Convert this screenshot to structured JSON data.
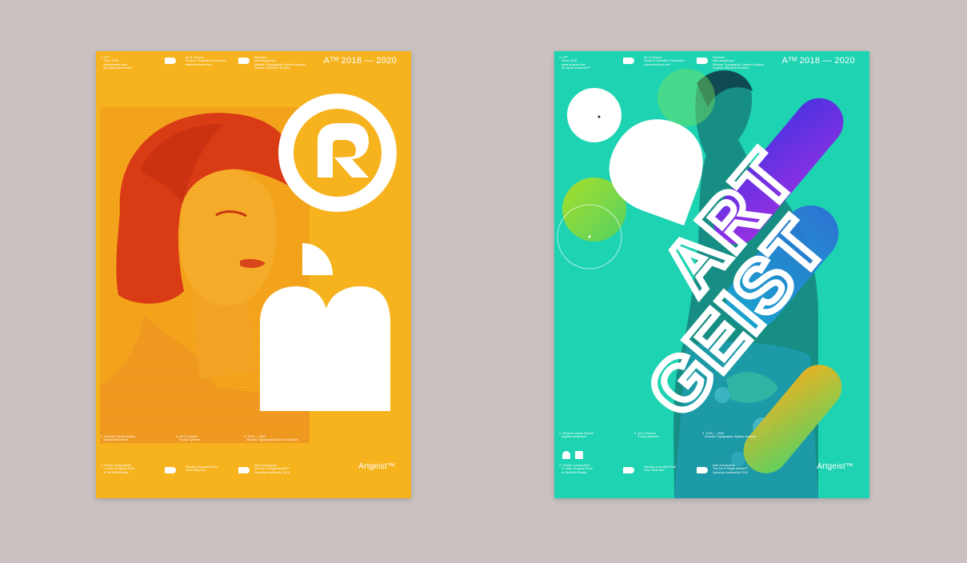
{
  "scene": {
    "background": "#c9c2c1"
  },
  "posters": [
    {
      "id": "left",
      "color": "#f6b31e",
      "year_range": "Aᵀᴹ 2018 — 2020",
      "brand": "Artgeist™",
      "header": [
        "●  Aᵀᴹ\n   Since 2018\n   www.artgeist.com\n   All rights preserved™",
        "Art & Science\nStudio & Scientific Foundation\nwww.artscience.net",
        "Swissted\nInterdisciplinary\nModular Typographic System Analysis\nGraphic Research Division"
      ],
      "middle": [
        "●  Modular Visual System\n   Applied Aesthetics",
        "●  Art & Science\n   Theory Systems",
        "●  2018 — 2020\n   Modular Typographic System Analysis"
      ],
      "footer": [
        "●  Kinetic Composition\n   & Order Program Work\n   of Sin With Reality",
        "Visually Grounded Field\nOver Wide Blur",
        "New Conceptual\nThe Art of Target Market™\nSystemic Authorship 2018"
      ]
    },
    {
      "id": "right",
      "color": "#1ed3b2",
      "year_range": "Aᵀᴹ 2018 — 2020",
      "brand": "Artgeist™",
      "headline": [
        "ART",
        "GEIST"
      ],
      "header": [
        "●  Aᵀᴹ\n   Since 2018\n   www.artgeist.com\n   All rights preserved™",
        "Art & Science\nStudio & Scientific Foundation\nwww.artscience.net",
        "Swissted\nInterdisciplinary\nModular Typographic System Analysis\nGraphic Research Division"
      ],
      "middle": [
        "●  Modular Visual System\n   Applied Aesthetics",
        "●  Art & Science\n   Theory Systems",
        "●  2018 — 2020\n   Modular Typographic System Analysis"
      ],
      "footer": [
        "●  Kinetic Composition\n   & Order Program Work\n   of Sin With Reality",
        "Visually Grounded Field\nOver Wide Blur",
        "New Conceptual\nThe Art of Target Market™\nSystemic Authorship 2018"
      ]
    }
  ]
}
